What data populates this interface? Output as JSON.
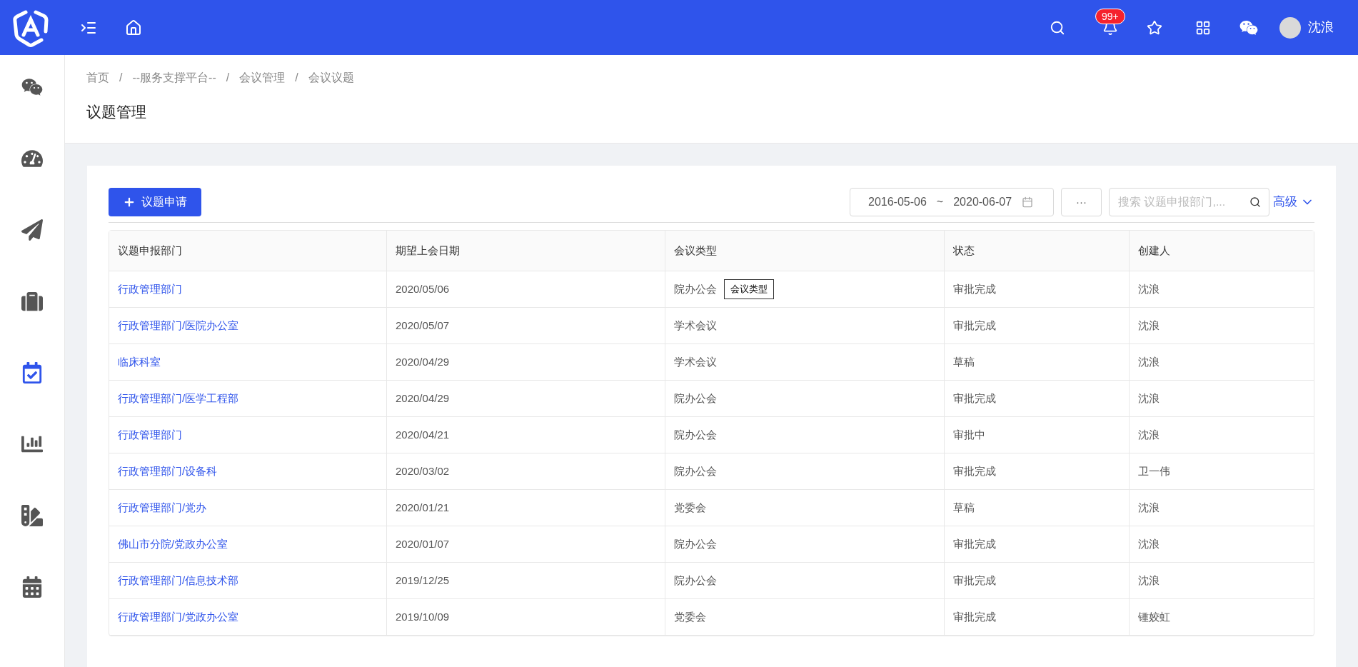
{
  "header": {
    "notification_badge": "99+",
    "user_name": "沈浪"
  },
  "sidebar": {
    "items": [
      {
        "kind": "wechat",
        "selected": false
      },
      {
        "kind": "dashboard",
        "selected": false
      },
      {
        "kind": "send",
        "selected": false
      },
      {
        "kind": "briefcase",
        "selected": false
      },
      {
        "kind": "calendar-check",
        "selected": true
      },
      {
        "kind": "chart",
        "selected": false
      },
      {
        "kind": "swatches",
        "selected": false
      },
      {
        "kind": "calendar",
        "selected": false
      }
    ]
  },
  "breadcrumb": [
    "首页",
    "--服务支撑平台--",
    "会议管理",
    "会议议题"
  ],
  "breadcrumb_separator": "/",
  "page_title": "议题管理",
  "toolbar": {
    "add_button": "议题申请",
    "date_start": "2016-05-06",
    "date_separator": "~",
    "date_end": "2020-06-07",
    "more_button": "···",
    "search": {
      "placeholder": "搜索 议题申报部门,..."
    },
    "advanced_link": "高级"
  },
  "table": {
    "columns": [
      "议题申报部门",
      "期望上会日期",
      "会议类型",
      "状态",
      "创建人"
    ],
    "rows": [
      {
        "department": "行政管理部门",
        "date": "2020/05/06",
        "type": "院办公会",
        "tooltip": "会议类型",
        "status": "审批完成",
        "creator": "沈浪"
      },
      {
        "department": "行政管理部门/医院办公室",
        "date": "2020/05/07",
        "type": "学术会议",
        "status": "审批完成",
        "creator": "沈浪"
      },
      {
        "department": "临床科室",
        "date": "2020/04/29",
        "type": "学术会议",
        "status": "草稿",
        "creator": "沈浪"
      },
      {
        "department": "行政管理部门/医学工程部",
        "date": "2020/04/29",
        "type": "院办公会",
        "status": "审批完成",
        "creator": "沈浪"
      },
      {
        "department": "行政管理部门",
        "date": "2020/04/21",
        "type": "院办公会",
        "status": "审批中",
        "creator": "沈浪"
      },
      {
        "department": "行政管理部门/设备科",
        "date": "2020/03/02",
        "type": "院办公会",
        "status": "审批完成",
        "creator": "卫一伟"
      },
      {
        "department": "行政管理部门/党办",
        "date": "2020/01/21",
        "type": "党委会",
        "status": "草稿",
        "creator": "沈浪"
      },
      {
        "department": "佛山市分院/党政办公室",
        "date": "2020/01/07",
        "type": "院办公会",
        "status": "审批完成",
        "creator": "沈浪"
      },
      {
        "department": "行政管理部门/信息技术部",
        "date": "2019/12/25",
        "type": "院办公会",
        "status": "审批完成",
        "creator": "沈浪"
      },
      {
        "department": "行政管理部门/党政办公室",
        "date": "2019/10/09",
        "type": "党委会",
        "status": "审批完成",
        "creator": "锺姣虹"
      }
    ]
  }
}
